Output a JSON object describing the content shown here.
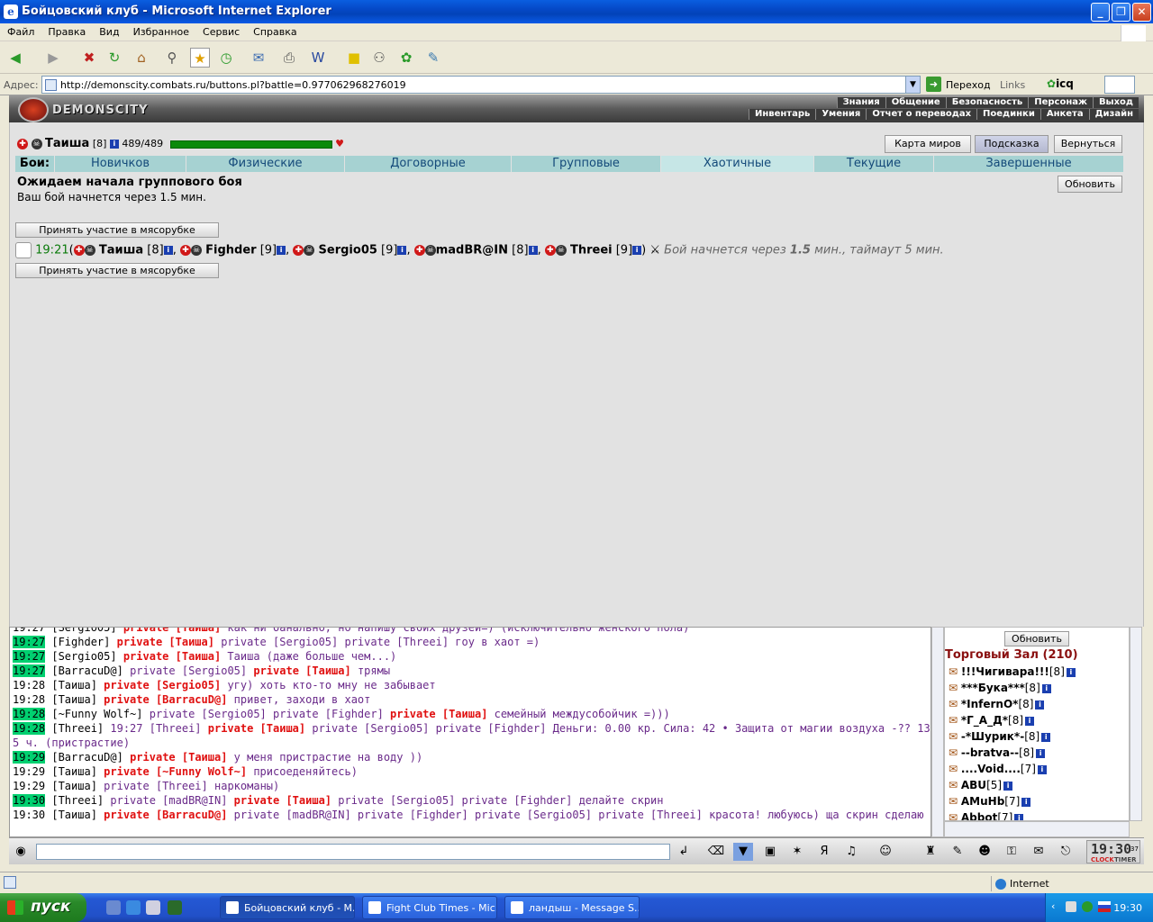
{
  "window": {
    "title": "Бойцовский клуб - Microsoft Internet Explorer"
  },
  "menu": [
    "Файл",
    "Правка",
    "Вид",
    "Избранное",
    "Сервис",
    "Справка"
  ],
  "address": {
    "label": "Адрес:",
    "url": "http://demonscity.combats.ru/buttons.pl?battle=0.977062968276019",
    "go": "Переход",
    "links": "Links",
    "icq": "icq"
  },
  "site": {
    "name": "DEMONSCITY",
    "nav1": [
      "Знания",
      "Общение",
      "Безопасность",
      "Персонаж",
      "Выход"
    ],
    "nav2": [
      "Инвентарь",
      "Умения",
      "Отчет о переводах",
      "Поединки",
      "Анкета",
      "Дизайн"
    ]
  },
  "player": {
    "name": "Таиша",
    "level": "[8]",
    "hp": "489/489"
  },
  "buttons": {
    "worldmap": "Карта миров",
    "hint": "Подсказка",
    "back": "Вернуться",
    "refresh": "Обновить",
    "join": "Принять участие в мясорубке"
  },
  "tabs": {
    "label": "Бои:",
    "items": [
      "Новичков",
      "Физические",
      "Договорные",
      "Групповые",
      "Хаотичные",
      "Текущие",
      "Завершенные"
    ]
  },
  "waiting": {
    "title": "Ожидаем начала группового боя",
    "subtitle": "Ваш бой начнется через 1.5 мин."
  },
  "battle": {
    "time": "19:21",
    "open": "(",
    "close": ")",
    "players": [
      {
        "name": "Таиша",
        "level": "[8]"
      },
      {
        "name": "Fighder",
        "level": "[9]"
      },
      {
        "name": "Sergio05",
        "level": "[9]"
      },
      {
        "name": "madBR@IN",
        "level": "[8]"
      },
      {
        "name": "Threei",
        "level": "[9]"
      }
    ],
    "info_pre": "Бой начнется через ",
    "info_num": "1.5",
    "info_post": " мин., таймаут 5 мин."
  },
  "chat": [
    {
      "t": "19:27",
      "hl": false,
      "parts": [
        [
          "un",
          "[Sergio05]"
        ],
        [
          "pr",
          " private [Таиша]"
        ],
        [
          "msg",
          " как ни банально, но напишу своих друзей=) (исключительно женского пола)"
        ]
      ]
    },
    {
      "t": "19:27",
      "hl": true,
      "parts": [
        [
          "un",
          "[Fighder]"
        ],
        [
          "pr",
          " private [Таиша]"
        ],
        [
          "pv",
          " private [Sergio05] private [Threei]"
        ],
        [
          "msg",
          " гоу в хаот =)"
        ]
      ]
    },
    {
      "t": "19:27",
      "hl": true,
      "parts": [
        [
          "un",
          "[Sergio05]"
        ],
        [
          "pr",
          " private [Таиша]"
        ],
        [
          "msg",
          " Таиша (даже больше чем...)"
        ]
      ]
    },
    {
      "t": "19:27",
      "hl": true,
      "parts": [
        [
          "un",
          "[BarracuD@]"
        ],
        [
          "pv",
          " private [Sergio05]"
        ],
        [
          "pr",
          " private [Таиша]"
        ],
        [
          "msg",
          " трямы"
        ]
      ]
    },
    {
      "t": "19:28",
      "hl": false,
      "parts": [
        [
          "un",
          "[Таиша]"
        ],
        [
          "pr",
          " private [Sergio05]"
        ],
        [
          "msg",
          " угу) хоть кто-то мну не забывает"
        ]
      ]
    },
    {
      "t": "19:28",
      "hl": false,
      "parts": [
        [
          "un",
          "[Таиша]"
        ],
        [
          "pr",
          " private [BarracuD@]"
        ],
        [
          "msg",
          " привет, заходи в хаот"
        ]
      ]
    },
    {
      "t": "19:28",
      "hl": true,
      "parts": [
        [
          "un",
          "[~Funny Wolf~]"
        ],
        [
          "pv",
          " private [Sergio05] private [Fighder]"
        ],
        [
          "pr",
          " private [Таиша]"
        ],
        [
          "msg",
          " семейный междусобойчик =)))"
        ]
      ]
    },
    {
      "t": "19:28",
      "hl": true,
      "parts": [
        [
          "un",
          "[Threei]"
        ],
        [
          "msg",
          " 19:27 [Threei]"
        ],
        [
          "pr",
          " private [Таиша]"
        ],
        [
          "pv",
          " private [Sergio05] private [Fighder]"
        ],
        [
          "msg",
          " Деньги: 0.00 кр. Сила: 42 • Защита от магии воздуха -?? 13 дн."
        ]
      ]
    },
    {
      "t": "",
      "hl": false,
      "parts": [
        [
          "msg",
          "5 ч. (пристрастие)"
        ]
      ]
    },
    {
      "t": "19:29",
      "hl": true,
      "parts": [
        [
          "un",
          "[BarracuD@]"
        ],
        [
          "pr",
          " private [Таиша]"
        ],
        [
          "msg",
          " у меня пристрастие на воду ))"
        ]
      ]
    },
    {
      "t": "19:29",
      "hl": false,
      "parts": [
        [
          "un",
          "[Таиша]"
        ],
        [
          "pr",
          " private [~Funny Wolf~]"
        ],
        [
          "msg",
          " присоеденяйтесь)"
        ]
      ]
    },
    {
      "t": "19:29",
      "hl": false,
      "parts": [
        [
          "un",
          "[Таиша]"
        ],
        [
          "pv",
          " private [Threei]"
        ],
        [
          "msg",
          " наркоманы)"
        ]
      ]
    },
    {
      "t": "19:30",
      "hl": true,
      "parts": [
        [
          "un",
          "[Threei]"
        ],
        [
          "pv",
          " private [madBR@IN]"
        ],
        [
          "pr",
          " private [Таиша]"
        ],
        [
          "pv",
          " private [Sergio05] private [Fighder]"
        ],
        [
          "msg",
          " делайте скрин"
        ]
      ]
    },
    {
      "t": "19:30",
      "hl": false,
      "parts": [
        [
          "un",
          "[Таиша]"
        ],
        [
          "pr",
          " private [BarracuD@]"
        ],
        [
          "pv",
          " private [madBR@IN] private [Fighder] private [Sergio05] private [Threei]"
        ],
        [
          "msg",
          " красота! любуюсь) ща скрин сделаю"
        ]
      ]
    }
  ],
  "room": {
    "name": "Торговый Зал (210)",
    "users": [
      {
        "name": "!!!Чигивара!!!",
        "level": "[8]"
      },
      {
        "name": "***Бука***",
        "level": "[8]"
      },
      {
        "name": "*InfernO*",
        "level": "[8]"
      },
      {
        "name": "*Г_А_Д*",
        "level": "[8]"
      },
      {
        "name": "-*Шурик*-",
        "level": "[8]"
      },
      {
        "name": "--bratva--",
        "level": "[8]"
      },
      {
        "name": "....Void....",
        "level": "[7]"
      },
      {
        "name": "ABU",
        "level": "[5]"
      },
      {
        "name": "AMuHb",
        "level": "[7]"
      },
      {
        "name": "Abbot",
        "level": "[7]"
      }
    ]
  },
  "clock": {
    "time": "19:30",
    "sec": "37",
    "label1": "CLOCK",
    "label2": "TIMER"
  },
  "status": {
    "zone": "Internet"
  },
  "taskbar": {
    "start": "пуск",
    "tasks": [
      "Бойцовский клуб - M...",
      "Fight Club Times - Mic...",
      "ландыш - Message S..."
    ],
    "time": "19:30"
  }
}
